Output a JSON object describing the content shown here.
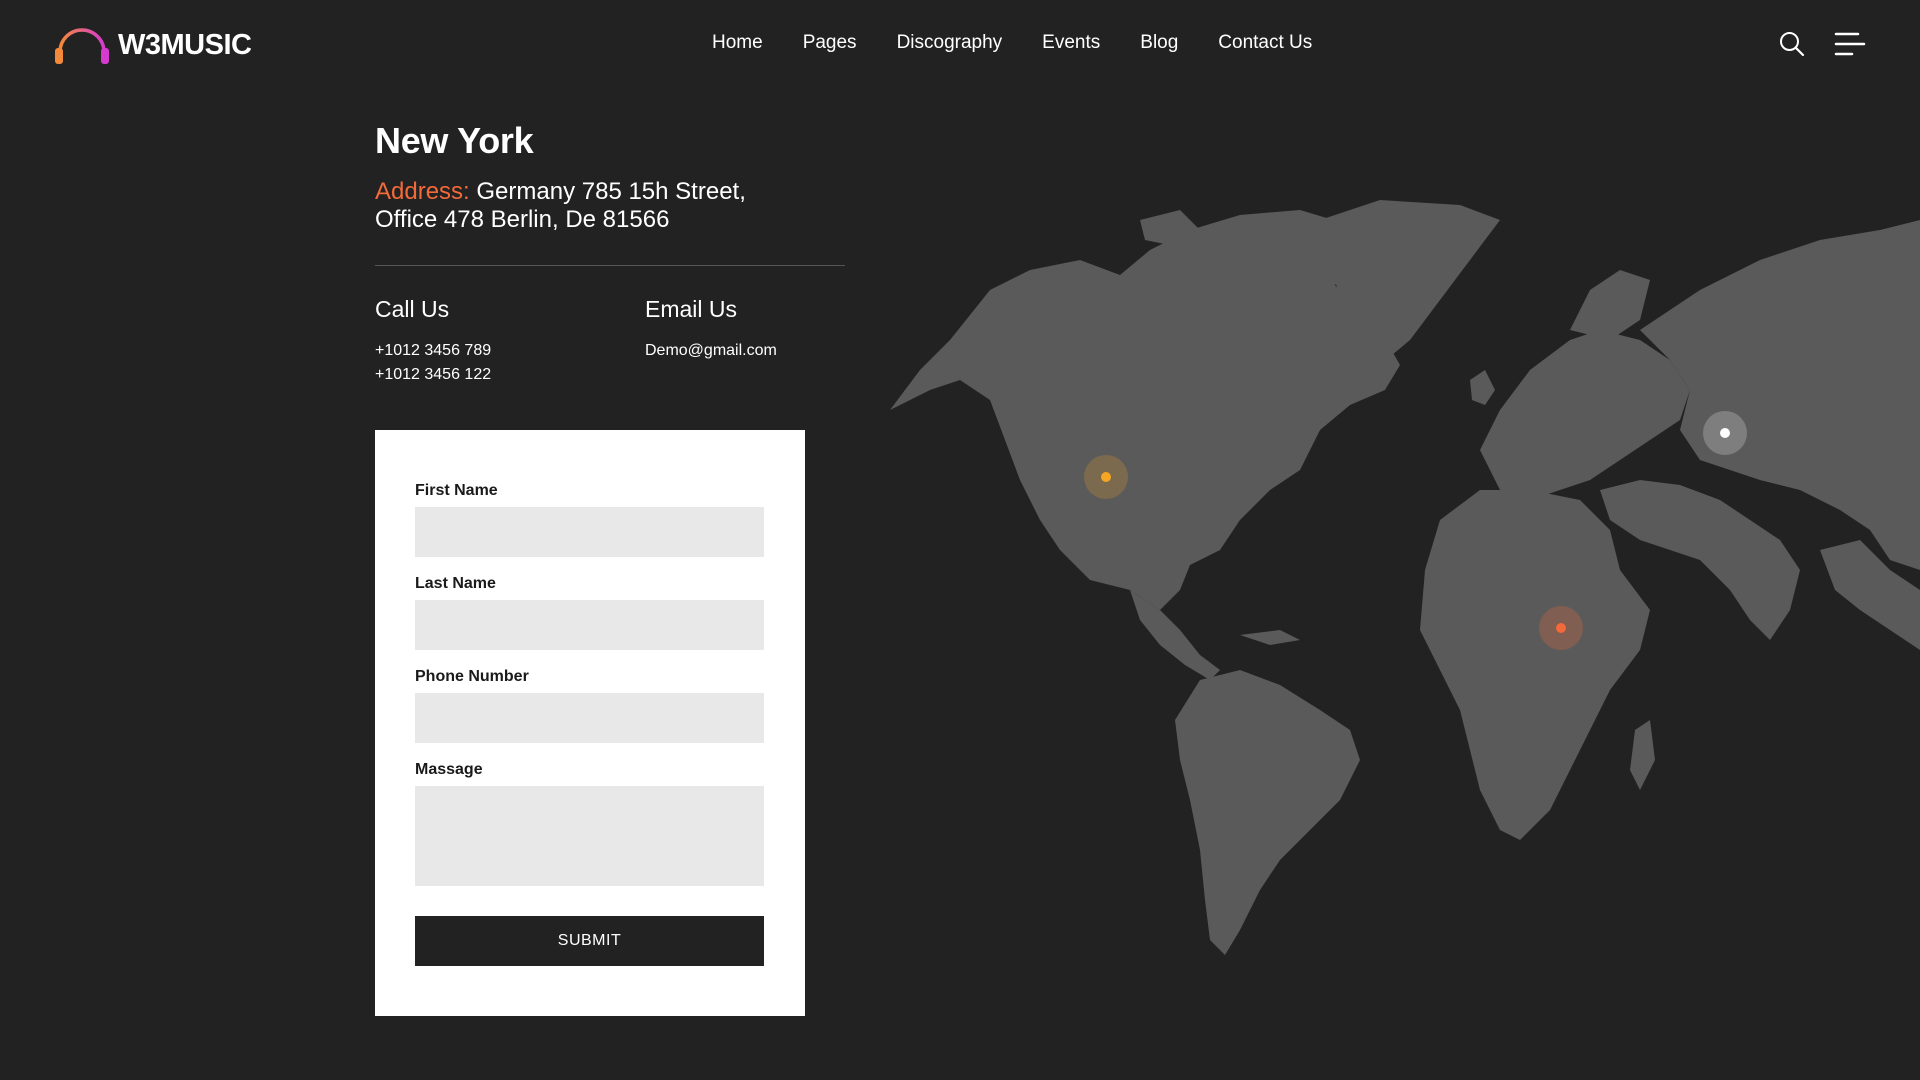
{
  "brand": {
    "name": "W3MUSIC",
    "accent": "#f26a3a"
  },
  "nav": {
    "items": [
      {
        "label": "Home"
      },
      {
        "label": "Pages"
      },
      {
        "label": "Discography"
      },
      {
        "label": "Events"
      },
      {
        "label": "Blog"
      },
      {
        "label": "Contact Us"
      }
    ]
  },
  "header_icons": {
    "search": "search-icon",
    "menu": "hamburger-menu-icon"
  },
  "location": {
    "city": "New York",
    "address_label": "Address:",
    "address_line1": " Germany 785 15h Street,",
    "address_line2": "Office 478 Berlin, De 81566"
  },
  "contact": {
    "call_title": "Call Us",
    "phones": [
      "+1012 3456 789",
      "+1012 3456 122"
    ],
    "email_title": "Email Us",
    "email": "Demo@gmail.com"
  },
  "form": {
    "first_name_label": "First Name",
    "first_name_value": "",
    "last_name_label": "Last Name",
    "last_name_value": "",
    "phone_label": "Phone Number",
    "phone_value": "",
    "message_label": "Massage",
    "message_value": "",
    "submit_label": "SUBMIT"
  },
  "map_markers": [
    {
      "name": "north-america",
      "color": "#f5a623"
    },
    {
      "name": "russia",
      "color": "#ffffff"
    },
    {
      "name": "africa",
      "color": "#f26a3a"
    }
  ]
}
